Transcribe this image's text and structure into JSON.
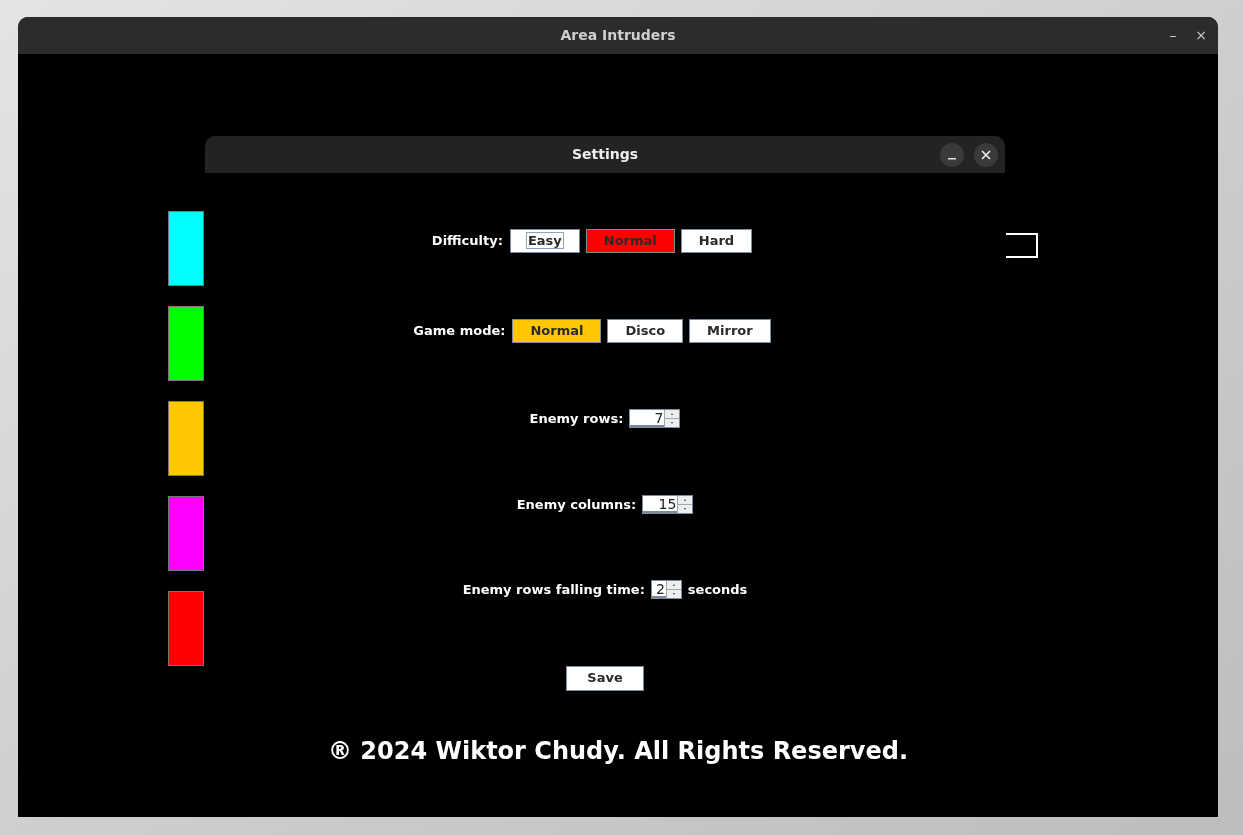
{
  "window": {
    "title": "Area Intruders",
    "controls": [
      "–",
      "×"
    ]
  },
  "swatches": [
    {
      "color": "#00ffff"
    },
    {
      "color": "#00ff00"
    },
    {
      "color": "#ffc800"
    },
    {
      "color": "#ff00ff"
    },
    {
      "color": "#ff0000"
    }
  ],
  "dialog": {
    "title": "Settings",
    "groups": [
      {
        "label": "Difficulty:",
        "color": "#ff0000",
        "options": [
          {
            "label": "Easy",
            "selected": false,
            "focused": true
          },
          {
            "label": "Normal",
            "selected": true,
            "focused": false
          },
          {
            "label": "Hard",
            "selected": false,
            "focused": false
          }
        ]
      },
      {
        "label": "Game mode:",
        "color": "#ffc800",
        "options": [
          {
            "label": "Normal",
            "selected": true,
            "focused": false
          },
          {
            "label": "Disco",
            "selected": false,
            "focused": false
          },
          {
            "label": "Mirror",
            "selected": false,
            "focused": false
          }
        ]
      }
    ],
    "spinners": [
      {
        "label": "Enemy rows:",
        "value": "7"
      },
      {
        "label": "Enemy columns:",
        "value": "15"
      },
      {
        "label": "Enemy rows falling time:",
        "value": "2",
        "suffix": "seconds"
      }
    ],
    "save": "Save"
  },
  "footer": "® 2024 Wiktor Chudy. All Rights Reserved."
}
